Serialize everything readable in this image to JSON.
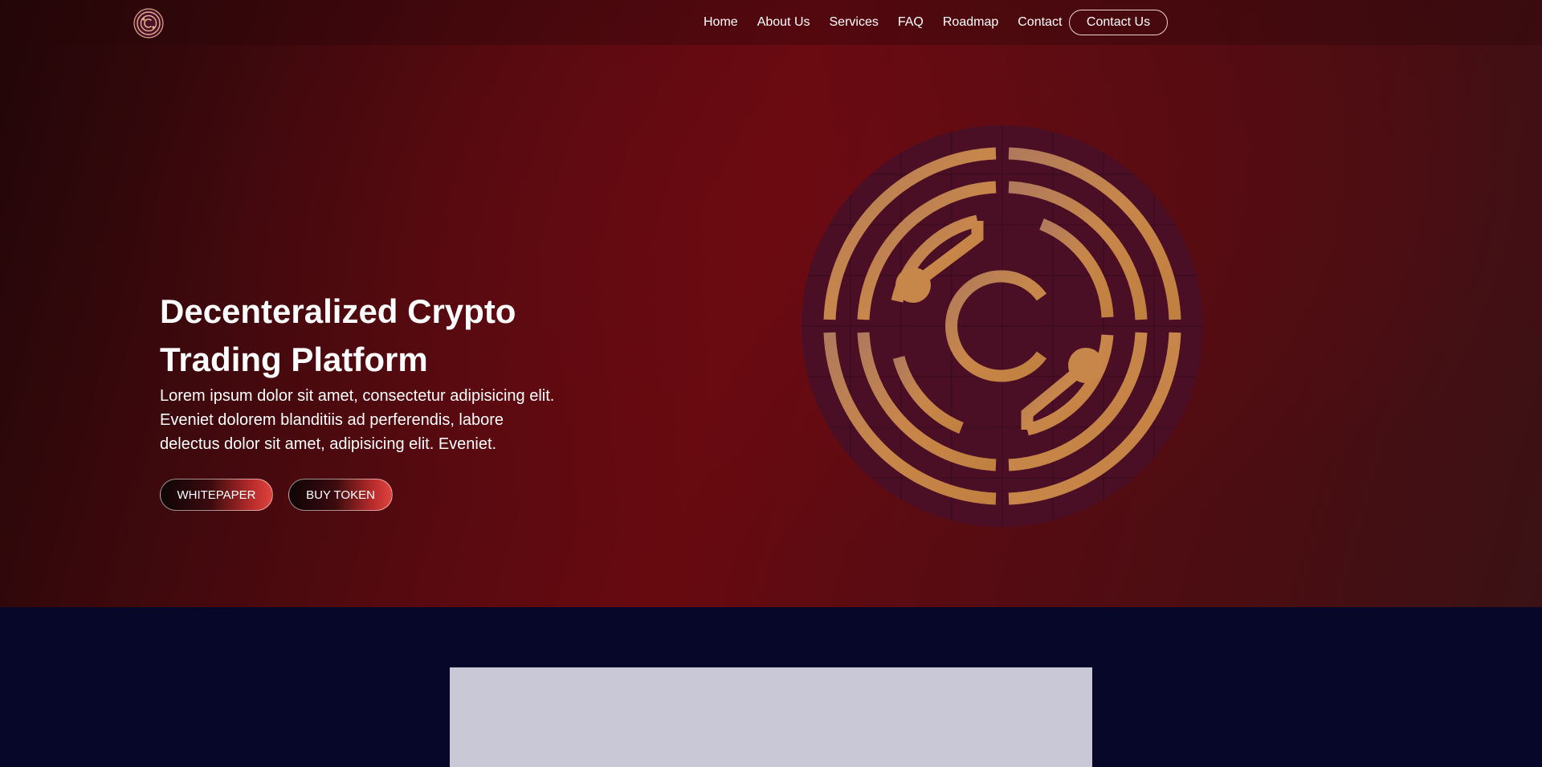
{
  "nav": {
    "links": [
      "Home",
      "About Us",
      "Services",
      "FAQ",
      "Roadmap",
      "Contact"
    ],
    "cta_label": "Contact Us"
  },
  "hero": {
    "title_line1": "Decenteralized Crypto",
    "title_line2": "Trading Platform",
    "text_line1": "Lorem ipsum dolor sit amet, consectetur adipisicing elit.",
    "text_line2": "Eveniet dolorem blanditiis ad perferendis, labore",
    "text_line3": "delectus dolor sit amet, adipisicing elit. Eveniet.",
    "primary_button": "WHITEPAPER",
    "secondary_button": "BUY TOKEN"
  },
  "colors": {
    "hero_red": "#670a10",
    "emblem_gold": "#c8874a",
    "emblem_disc": "#4a0f24",
    "lower_bg": "#07072a",
    "panel": "#c8c8d6"
  },
  "icons": {
    "logo": "crypto-coin-logo-icon",
    "emblem": "crypto-coin-emblem-icon"
  }
}
